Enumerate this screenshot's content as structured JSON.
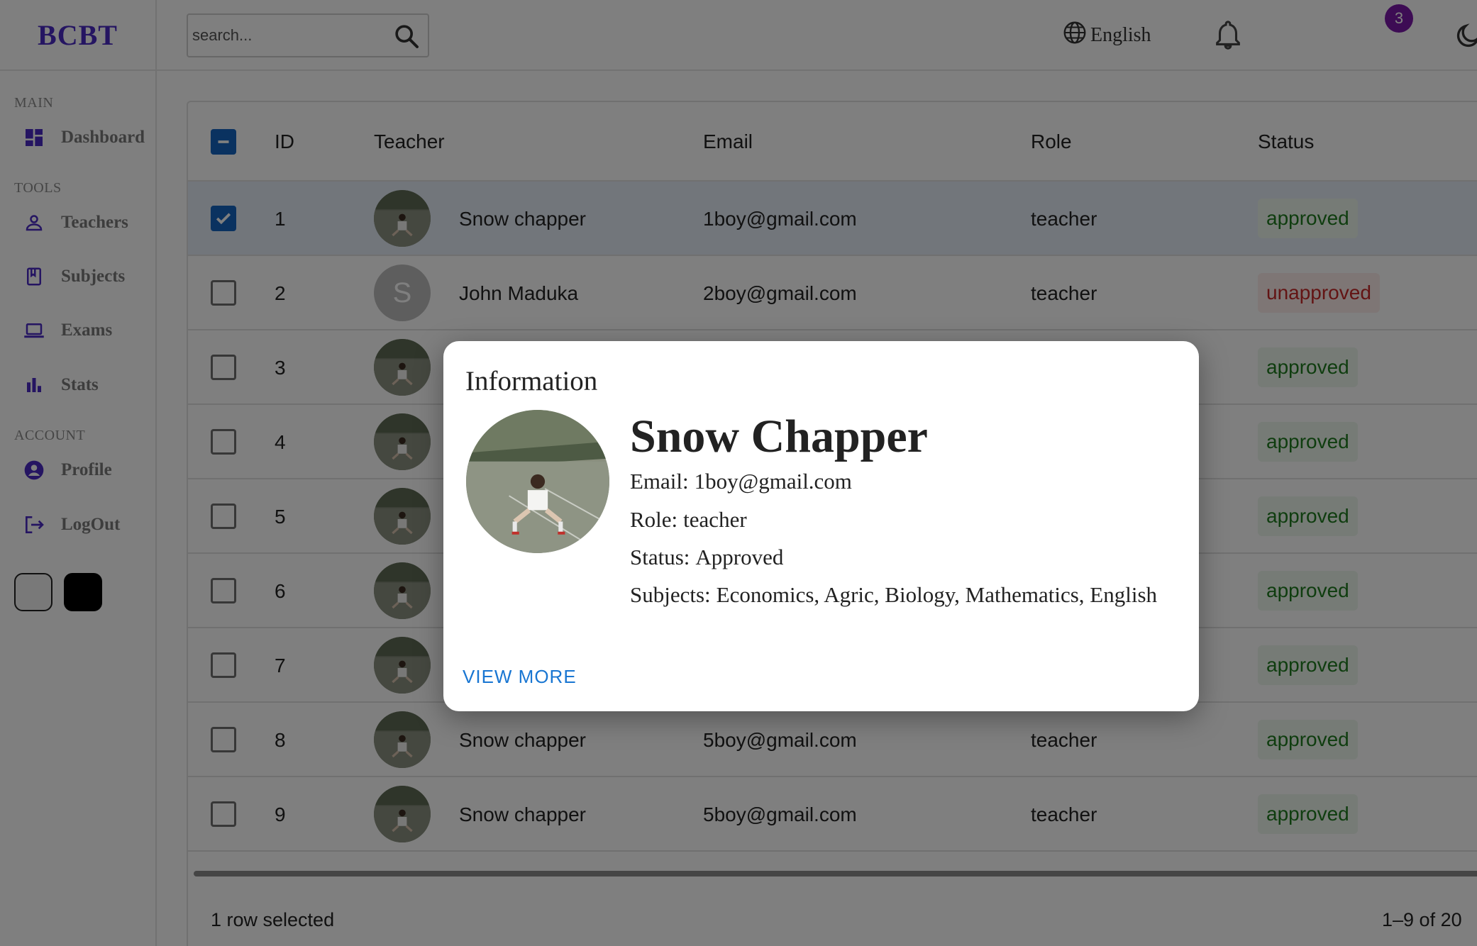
{
  "app": {
    "logo": "BCBT"
  },
  "sidebar": {
    "sections": [
      {
        "title": "MAIN"
      },
      {
        "title": "TOOLS"
      },
      {
        "title": "ACCOUNT"
      }
    ],
    "items": [
      {
        "label": "Dashboard",
        "icon": "dashboard-icon"
      },
      {
        "label": "Teachers",
        "icon": "person-icon"
      },
      {
        "label": "Subjects",
        "icon": "book-icon"
      },
      {
        "label": "Exams",
        "icon": "laptop-icon"
      },
      {
        "label": "Stats",
        "icon": "bar-chart-icon"
      },
      {
        "label": "Profile",
        "icon": "account-circle-icon"
      },
      {
        "label": "LogOut",
        "icon": "logout-icon"
      }
    ],
    "accent_color": "#4b2bc4",
    "theme_swatches": [
      {
        "color": "#f3f3f3"
      },
      {
        "color": "#000000"
      }
    ]
  },
  "topbar": {
    "search_placeholder": "search...",
    "language": "English",
    "notification_count": "3"
  },
  "grid": {
    "columns": [
      "ID",
      "Teacher",
      "Email",
      "Role",
      "Status"
    ],
    "rows": [
      {
        "id": "1",
        "name": "Snow chapper",
        "email": "1boy@gmail.com",
        "role": "teacher",
        "status": "approved"
      },
      {
        "id": "2",
        "name": "John Maduka",
        "email": "2boy@gmail.com",
        "role": "teacher",
        "status": "unapproved",
        "avatar_letter": "S"
      },
      {
        "id": "3",
        "name": "",
        "email": "",
        "role": "",
        "status": "approved"
      },
      {
        "id": "4",
        "name": "",
        "email": "",
        "role": "",
        "status": "approved"
      },
      {
        "id": "5",
        "name": "",
        "email": "",
        "role": "",
        "status": "approved"
      },
      {
        "id": "6",
        "name": "",
        "email": "",
        "role": "",
        "status": "approved"
      },
      {
        "id": "7",
        "name": "",
        "email": "",
        "role": "",
        "status": "approved"
      },
      {
        "id": "8",
        "name": "Snow chapper",
        "email": "5boy@gmail.com",
        "role": "teacher",
        "status": "approved"
      },
      {
        "id": "9",
        "name": "Snow chapper",
        "email": "5boy@gmail.com",
        "role": "teacher",
        "status": "approved"
      }
    ],
    "footer_selected": "1 row selected",
    "footer_pagination": "1–9 of 20",
    "status_colors": {
      "approved": "#1e7a1e",
      "unapproved": "#c62828"
    }
  },
  "dialog": {
    "title": "Information",
    "name": "Snow Chapper",
    "email_label": "Email:",
    "email": "1boy@gmail.com",
    "role_label": "Role:",
    "role": "teacher",
    "status_label": "Status:",
    "status": "Approved",
    "subjects_label": "Subjects:",
    "subjects": "Economics, Agric, Biology, Mathematics, English",
    "view_more": "VIEW MORE"
  }
}
